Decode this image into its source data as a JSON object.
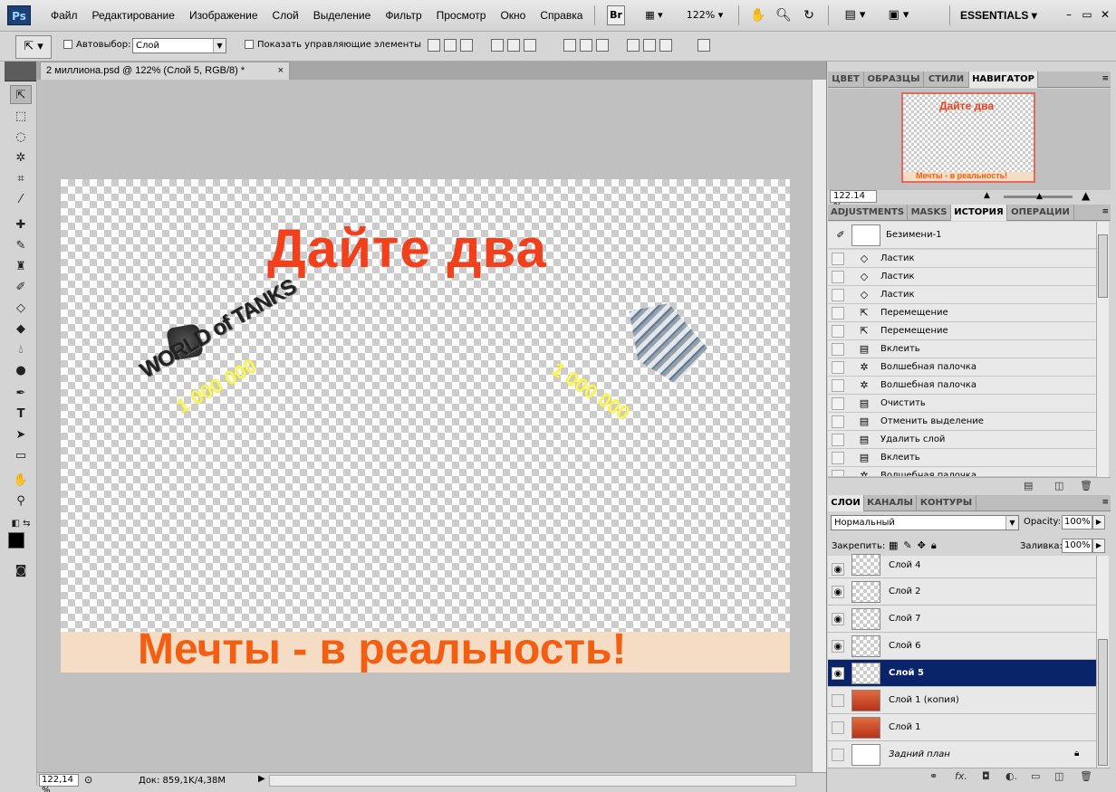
{
  "app": {
    "logo": "Ps"
  },
  "menu": [
    "Файл",
    "Редактирование",
    "Изображение",
    "Слой",
    "Выделение",
    "Фильтр",
    "Просмотр",
    "Окно",
    "Справка"
  ],
  "menubar": {
    "bridge_label": "Br",
    "zoom_label": "122%",
    "workspace": "ESSENTIALS"
  },
  "options": {
    "autoselect_label": "Автовыбор:",
    "autoselect_value": "Слой",
    "show_controls_label": "Показать управляющие элементы"
  },
  "document": {
    "tab_title": "2 миллиона.psd @ 122% (Слой 5, RGB/8) *",
    "close_label": "×",
    "headline": "Дайте два",
    "footer_text": "Мечты -  в реальность!",
    "left_logo_text": "WORLD of TANKS",
    "left_number": "1 000 000",
    "right_number": "1 000 000"
  },
  "status": {
    "zoom": "122,14 %",
    "doc_info": "Док: 859,1K/4,38M"
  },
  "navigator": {
    "tabs": [
      "ЦВЕТ",
      "ОБРАЗЦЫ",
      "СТИЛИ",
      "НАВИГАТОР"
    ],
    "active_tab": 3,
    "zoom": "122.14 %",
    "thumb_headline": "Дайте два",
    "thumb_footer": "Мечты - в реальность!"
  },
  "history": {
    "tabs": [
      "ADJUSTMENTS",
      "MASKS",
      "ИСТОРИЯ",
      "ОПЕРАЦИИ"
    ],
    "active_tab": 2,
    "snapshot": "Безимени-1",
    "items": [
      {
        "label": "Ластик",
        "icon": "eraser-icon"
      },
      {
        "label": "Ластик",
        "icon": "eraser-icon"
      },
      {
        "label": "Ластик",
        "icon": "eraser-icon"
      },
      {
        "label": "Перемещение",
        "icon": "move-icon"
      },
      {
        "label": "Перемещение",
        "icon": "move-icon"
      },
      {
        "label": "Вклеить",
        "icon": "document-icon"
      },
      {
        "label": "Волшебная палочка",
        "icon": "magic-wand-icon"
      },
      {
        "label": "Волшебная палочка",
        "icon": "magic-wand-icon"
      },
      {
        "label": "Очистить",
        "icon": "document-icon"
      },
      {
        "label": "Отменить выделение",
        "icon": "document-icon"
      },
      {
        "label": "Удалить слой",
        "icon": "document-icon"
      },
      {
        "label": "Вклеить",
        "icon": "document-icon"
      },
      {
        "label": "Волшебная палочка",
        "icon": "magic-wand-icon"
      }
    ]
  },
  "layers": {
    "tabs": [
      "СЛОИ",
      "КАНАЛЫ",
      "КОНТУРЫ"
    ],
    "active_tab": 0,
    "blend_mode": "Нормальный",
    "opacity_label": "Opacity:",
    "opacity": "100%",
    "lock_label": "Закрепить:",
    "fill_label": "Заливка:",
    "fill": "100%",
    "items": [
      {
        "name": "Слой 4",
        "visible": true,
        "selected": false
      },
      {
        "name": "Слой 2",
        "visible": true,
        "selected": false
      },
      {
        "name": "Слой 7",
        "visible": true,
        "selected": false
      },
      {
        "name": "Слой 6",
        "visible": true,
        "selected": false
      },
      {
        "name": "Слой 5",
        "visible": true,
        "selected": true
      },
      {
        "name": "Слой 1 (копия)",
        "visible": false,
        "selected": false
      },
      {
        "name": "Слой 1",
        "visible": false,
        "selected": false
      },
      {
        "name": "Задний план",
        "visible": false,
        "selected": false
      }
    ]
  },
  "colors": {
    "headline": "#f1401b",
    "footer": "#f35e12",
    "number": "#fbf55d",
    "selected_layer": "#0a246a"
  }
}
